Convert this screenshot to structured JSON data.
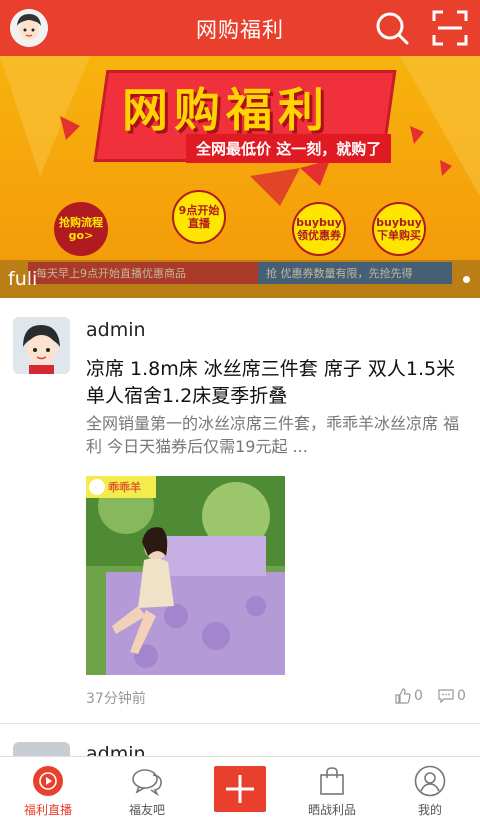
{
  "header": {
    "title": "网购福利",
    "avatar_icon": "avatar-icon",
    "search_icon": "search-icon",
    "scan_icon": "scan-icon",
    "accent": "#e8402c"
  },
  "banner": {
    "headline": "网购福利",
    "slogan": "全网最低价 这一刻，就购了",
    "bubbles": [
      "抢购流程go>",
      "9点开始直播",
      "buybuy领优惠券",
      "buybuy下单购买"
    ],
    "strip_left": "每天早上9点开始直播优惠商品",
    "strip_right": "抢 优惠券数量有限，先抢先得",
    "caption": "fuli"
  },
  "post": {
    "author": "admin",
    "title": "凉席 1.8m床 冰丝席三件套 席子 双人1.5米单人宿舍1.2床夏季折叠",
    "description": "全网销量第一的冰丝凉席三件套，乖乖羊冰丝凉席 福利 今日天猫券后仅需19元起 ...",
    "brand_tag": "乖乖羊",
    "time": "37分钟前",
    "likes": "0",
    "comments": "0"
  },
  "post2": {
    "author": "admin"
  },
  "nav": {
    "items": [
      {
        "label": "福利直播",
        "icon": "play-circle-icon",
        "active": true
      },
      {
        "label": "福友吧",
        "icon": "chat-bubbles-icon",
        "active": false
      },
      {
        "label": "",
        "icon": "plus-icon",
        "active": false
      },
      {
        "label": "晒战利品",
        "icon": "shopping-bag-icon",
        "active": false
      },
      {
        "label": "我的",
        "icon": "user-icon",
        "active": false
      }
    ]
  }
}
